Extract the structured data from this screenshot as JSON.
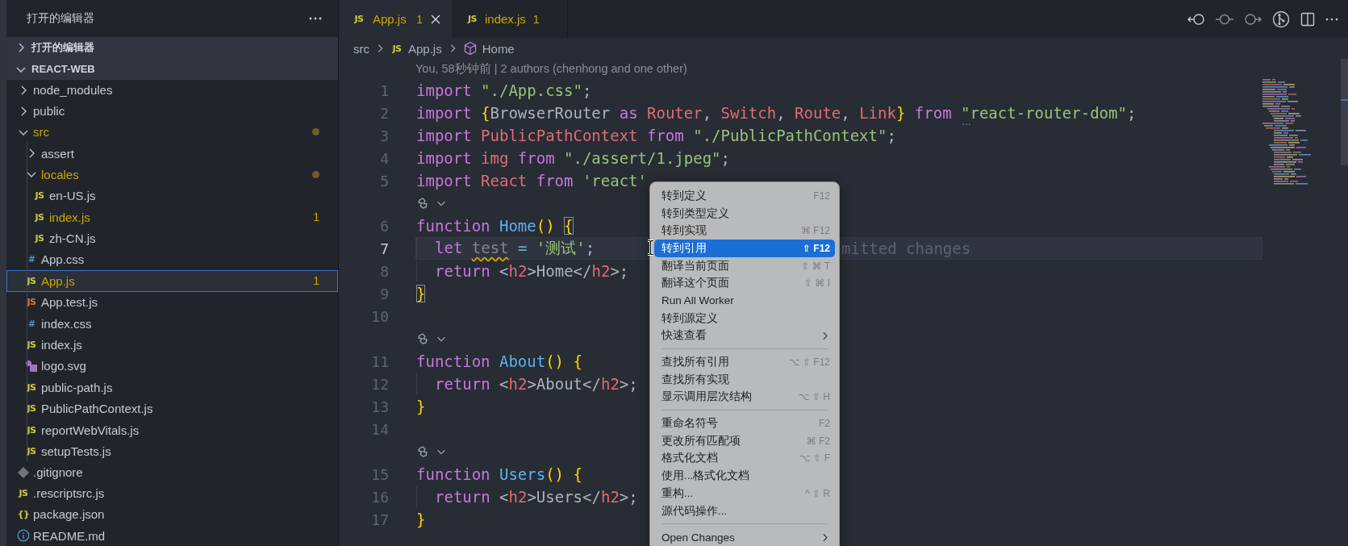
{
  "sidebar": {
    "title": "打开的编辑器",
    "sections": [
      {
        "label": "打开的编辑器",
        "expanded": false
      },
      {
        "label": "REACT-WEB",
        "expanded": true
      }
    ],
    "tree": [
      {
        "name": "node_modules",
        "kind": "folder",
        "expanded": false,
        "dot": false,
        "modified": false,
        "selected": false
      },
      {
        "name": "public",
        "kind": "folder",
        "expanded": false,
        "dot": false,
        "modified": false,
        "selected": false
      },
      {
        "name": "src",
        "kind": "folder",
        "expanded": true,
        "dot": true,
        "modified": true,
        "selected": false,
        "children": [
          {
            "name": "assert",
            "kind": "folder",
            "expanded": false,
            "dot": false,
            "modified": false,
            "selected": false
          },
          {
            "name": "locales",
            "kind": "folder",
            "expanded": true,
            "dot": true,
            "modified": true,
            "selected": false,
            "children": [
              {
                "name": "en-US.js",
                "kind": "js",
                "glyph": "JS",
                "modified": false,
                "selected": false
              },
              {
                "name": "index.js",
                "kind": "js",
                "glyph": "JS",
                "modified": true,
                "badge": "1",
                "selected": false
              },
              {
                "name": "zh-CN.js",
                "kind": "js",
                "glyph": "JS",
                "modified": false,
                "selected": false
              }
            ]
          },
          {
            "name": "App.css",
            "kind": "css",
            "glyph": "#",
            "modified": false,
            "selected": false
          },
          {
            "name": "App.js",
            "kind": "js",
            "glyph": "JS",
            "modified": true,
            "badge": "1",
            "selected": true
          },
          {
            "name": "App.test.js",
            "kind": "test",
            "glyph": "JS",
            "modified": false,
            "selected": false
          },
          {
            "name": "index.css",
            "kind": "css",
            "glyph": "#",
            "modified": false,
            "selected": false
          },
          {
            "name": "index.js",
            "kind": "js",
            "glyph": "JS",
            "modified": false,
            "selected": false
          },
          {
            "name": "logo.svg",
            "kind": "image",
            "modified": false,
            "selected": false
          },
          {
            "name": "public-path.js",
            "kind": "js",
            "glyph": "JS",
            "modified": false,
            "selected": false
          },
          {
            "name": "PublicPathContext.js",
            "kind": "js",
            "glyph": "JS",
            "modified": false,
            "selected": false
          },
          {
            "name": "reportWebVitals.js",
            "kind": "js",
            "glyph": "JS",
            "modified": false,
            "selected": false
          },
          {
            "name": "setupTests.js",
            "kind": "js",
            "glyph": "JS",
            "modified": false,
            "selected": false
          }
        ]
      },
      {
        "name": ".gitignore",
        "kind": "git",
        "modified": false,
        "selected": false
      },
      {
        "name": ".rescriptsrc.js",
        "kind": "js",
        "glyph": "JS",
        "modified": false,
        "selected": false
      },
      {
        "name": "package.json",
        "kind": "json",
        "glyph": "{}",
        "modified": false,
        "selected": false
      },
      {
        "name": "README.md",
        "kind": "info",
        "modified": false,
        "selected": false
      }
    ]
  },
  "editor": {
    "tabs": [
      {
        "label": "App.js",
        "glyph": "JS",
        "badge": "1",
        "selected": true
      },
      {
        "label": "index.js",
        "glyph": "JS",
        "badge": "1",
        "selected": false
      }
    ],
    "breadcrumb": [
      {
        "label": "src",
        "kind": "folder"
      },
      {
        "label": "App.js",
        "kind": "js",
        "glyph": "JS"
      },
      {
        "label": "Home",
        "kind": "symbol"
      }
    ],
    "blame": "You, 58秒钟前 | 2 authors (chenhong and one other)",
    "lines": [
      {
        "kind": "code",
        "number": "1",
        "indented": false,
        "current": false,
        "tokens": [
          {
            "text": "import ",
            "kind": "keyword"
          },
          {
            "text": "\"./App.css\"",
            "kind": "string"
          },
          {
            "text": ";",
            "kind": "plain"
          }
        ]
      },
      {
        "kind": "code",
        "number": "2",
        "indented": false,
        "current": false,
        "hint": "…",
        "tokens": [
          {
            "text": "import ",
            "kind": "keyword"
          },
          {
            "text": "{",
            "kind": "bracket"
          },
          {
            "text": "BrowserRouter ",
            "kind": "plain"
          },
          {
            "text": "as ",
            "kind": "keyword"
          },
          {
            "text": "Router",
            "kind": "variable"
          },
          {
            "text": ", ",
            "kind": "plain"
          },
          {
            "text": "Switch",
            "kind": "variable"
          },
          {
            "text": ", ",
            "kind": "plain"
          },
          {
            "text": "Route",
            "kind": "variable"
          },
          {
            "text": ", ",
            "kind": "plain"
          },
          {
            "text": "Link",
            "kind": "variable"
          },
          {
            "text": "} ",
            "kind": "bracket"
          },
          {
            "text": "from ",
            "kind": "keyword"
          },
          {
            "text": "\"react-router-dom\"",
            "kind": "string"
          },
          {
            "text": ";",
            "kind": "plain"
          }
        ]
      },
      {
        "kind": "code",
        "number": "3",
        "indented": false,
        "current": false,
        "tokens": [
          {
            "text": "import ",
            "kind": "keyword"
          },
          {
            "text": "PublicPathContext ",
            "kind": "variable"
          },
          {
            "text": "from ",
            "kind": "keyword"
          },
          {
            "text": "\"./PublicPathContext\"",
            "kind": "string"
          },
          {
            "text": ";",
            "kind": "plain"
          }
        ]
      },
      {
        "kind": "code",
        "number": "4",
        "indented": false,
        "current": false,
        "tokens": [
          {
            "text": "import ",
            "kind": "keyword"
          },
          {
            "text": "img ",
            "kind": "variable"
          },
          {
            "text": "from ",
            "kind": "keyword"
          },
          {
            "text": "\"./assert/1.jpeg\"",
            "kind": "string"
          },
          {
            "text": ";",
            "kind": "plain"
          }
        ]
      },
      {
        "kind": "code",
        "number": "5",
        "indented": false,
        "current": false,
        "tokens": [
          {
            "text": "import ",
            "kind": "keyword"
          },
          {
            "text": "React ",
            "kind": "variable"
          },
          {
            "text": "from ",
            "kind": "keyword"
          },
          {
            "text": "'react'",
            "kind": "string"
          }
        ]
      },
      {
        "kind": "lens"
      },
      {
        "kind": "code",
        "number": "6",
        "indented": false,
        "current": false,
        "tokens": [
          {
            "text": "function ",
            "kind": "keyword"
          },
          {
            "text": "Home",
            "kind": "function"
          },
          {
            "text": "() ",
            "kind": "bracket"
          },
          {
            "text": "{",
            "kind": "matched"
          }
        ]
      },
      {
        "kind": "code",
        "number": "7",
        "indented": true,
        "current": true,
        "ghost": "mitted changes",
        "tokens": [
          {
            "text": "let ",
            "kind": "keyword"
          },
          {
            "text": "test",
            "kind": "unused"
          },
          {
            "text": " = ",
            "kind": "operator"
          },
          {
            "text": "'测试'",
            "kind": "string"
          },
          {
            "text": ";",
            "kind": "plain"
          }
        ]
      },
      {
        "kind": "code",
        "number": "8",
        "indented": true,
        "current": false,
        "tokens": [
          {
            "text": "return ",
            "kind": "keyword"
          },
          {
            "text": "<",
            "kind": "plain"
          },
          {
            "text": "h2",
            "kind": "tag"
          },
          {
            "text": ">Home</",
            "kind": "plain"
          },
          {
            "text": "h2",
            "kind": "tag"
          },
          {
            "text": ">;",
            "kind": "plain"
          }
        ]
      },
      {
        "kind": "code",
        "number": "9",
        "indented": false,
        "current": false,
        "tokens": [
          {
            "text": "}",
            "kind": "matched"
          }
        ]
      },
      {
        "kind": "code",
        "number": "10",
        "indented": false,
        "current": false
      },
      {
        "kind": "lens"
      },
      {
        "kind": "code",
        "number": "11",
        "indented": false,
        "current": false,
        "tokens": [
          {
            "text": "function ",
            "kind": "keyword"
          },
          {
            "text": "About",
            "kind": "function"
          },
          {
            "text": "() ",
            "kind": "bracket"
          },
          {
            "text": "{",
            "kind": "bracket"
          }
        ]
      },
      {
        "kind": "code",
        "number": "12",
        "indented": true,
        "current": false,
        "tokens": [
          {
            "text": "return ",
            "kind": "keyword"
          },
          {
            "text": "<",
            "kind": "plain"
          },
          {
            "text": "h2",
            "kind": "tag"
          },
          {
            "text": ">About</",
            "kind": "plain"
          },
          {
            "text": "h2",
            "kind": "tag"
          },
          {
            "text": ">;",
            "kind": "plain"
          }
        ]
      },
      {
        "kind": "code",
        "number": "13",
        "indented": false,
        "current": false,
        "tokens": [
          {
            "text": "}",
            "kind": "bracket"
          }
        ]
      },
      {
        "kind": "code",
        "number": "14",
        "indented": false,
        "current": false
      },
      {
        "kind": "lens"
      },
      {
        "kind": "code",
        "number": "15",
        "indented": false,
        "current": false,
        "tokens": [
          {
            "text": "function ",
            "kind": "keyword"
          },
          {
            "text": "Users",
            "kind": "function"
          },
          {
            "text": "() ",
            "kind": "bracket"
          },
          {
            "text": "{",
            "kind": "bracket"
          }
        ]
      },
      {
        "kind": "code",
        "number": "16",
        "indented": true,
        "current": false,
        "tokens": [
          {
            "text": "return ",
            "kind": "keyword"
          },
          {
            "text": "<",
            "kind": "plain"
          },
          {
            "text": "h2",
            "kind": "tag"
          },
          {
            "text": ">Users</",
            "kind": "plain"
          },
          {
            "text": "h2",
            "kind": "tag"
          },
          {
            "text": ">;",
            "kind": "plain"
          }
        ]
      },
      {
        "kind": "code",
        "number": "17",
        "indented": false,
        "current": false,
        "tokens": [
          {
            "text": "}",
            "kind": "bracket"
          }
        ]
      }
    ]
  },
  "context_menu": {
    "items": [
      {
        "kind": "item",
        "label": "转到定义",
        "shortcut": "F12",
        "selected": false
      },
      {
        "kind": "item",
        "label": "转到类型定义",
        "selected": false
      },
      {
        "kind": "item",
        "label": "转到实现",
        "shortcut": "⌘ F12",
        "selected": false
      },
      {
        "kind": "item",
        "label": "转到引用",
        "shortcut": "⇧ F12",
        "selected": true
      },
      {
        "kind": "item",
        "label": "翻译当前页面",
        "shortcut": "⇧ ⌘ T",
        "selected": false
      },
      {
        "kind": "item",
        "label": "翻译这个页面",
        "shortcut": "⇧ ⌘ I",
        "selected": false
      },
      {
        "kind": "item",
        "label": "Run All Worker",
        "selected": false
      },
      {
        "kind": "item",
        "label": "转到源定义",
        "selected": false
      },
      {
        "kind": "submenu",
        "label": "快速查看",
        "selected": false
      },
      {
        "kind": "separator"
      },
      {
        "kind": "item",
        "label": "查找所有引用",
        "shortcut": "⌥ ⇧ F12",
        "selected": false
      },
      {
        "kind": "item",
        "label": "查找所有实现",
        "selected": false
      },
      {
        "kind": "item",
        "label": "显示调用层次结构",
        "shortcut": "⌥ ⇧ H",
        "selected": false
      },
      {
        "kind": "separator"
      },
      {
        "kind": "item",
        "label": "重命名符号",
        "shortcut": "F2",
        "selected": false
      },
      {
        "kind": "item",
        "label": "更改所有匹配项",
        "shortcut": "⌘ F2",
        "selected": false
      },
      {
        "kind": "item",
        "label": "格式化文档",
        "shortcut": "⌥ ⇧ F",
        "selected": false
      },
      {
        "kind": "item",
        "label": "使用...格式化文档",
        "selected": false
      },
      {
        "kind": "item",
        "label": "重构...",
        "shortcut": "^ ⇧ R",
        "selected": false
      },
      {
        "kind": "item",
        "label": "源代码操作...",
        "selected": false
      },
      {
        "kind": "separator"
      },
      {
        "kind": "submenu",
        "label": "Open Changes",
        "selected": false
      }
    ]
  }
}
